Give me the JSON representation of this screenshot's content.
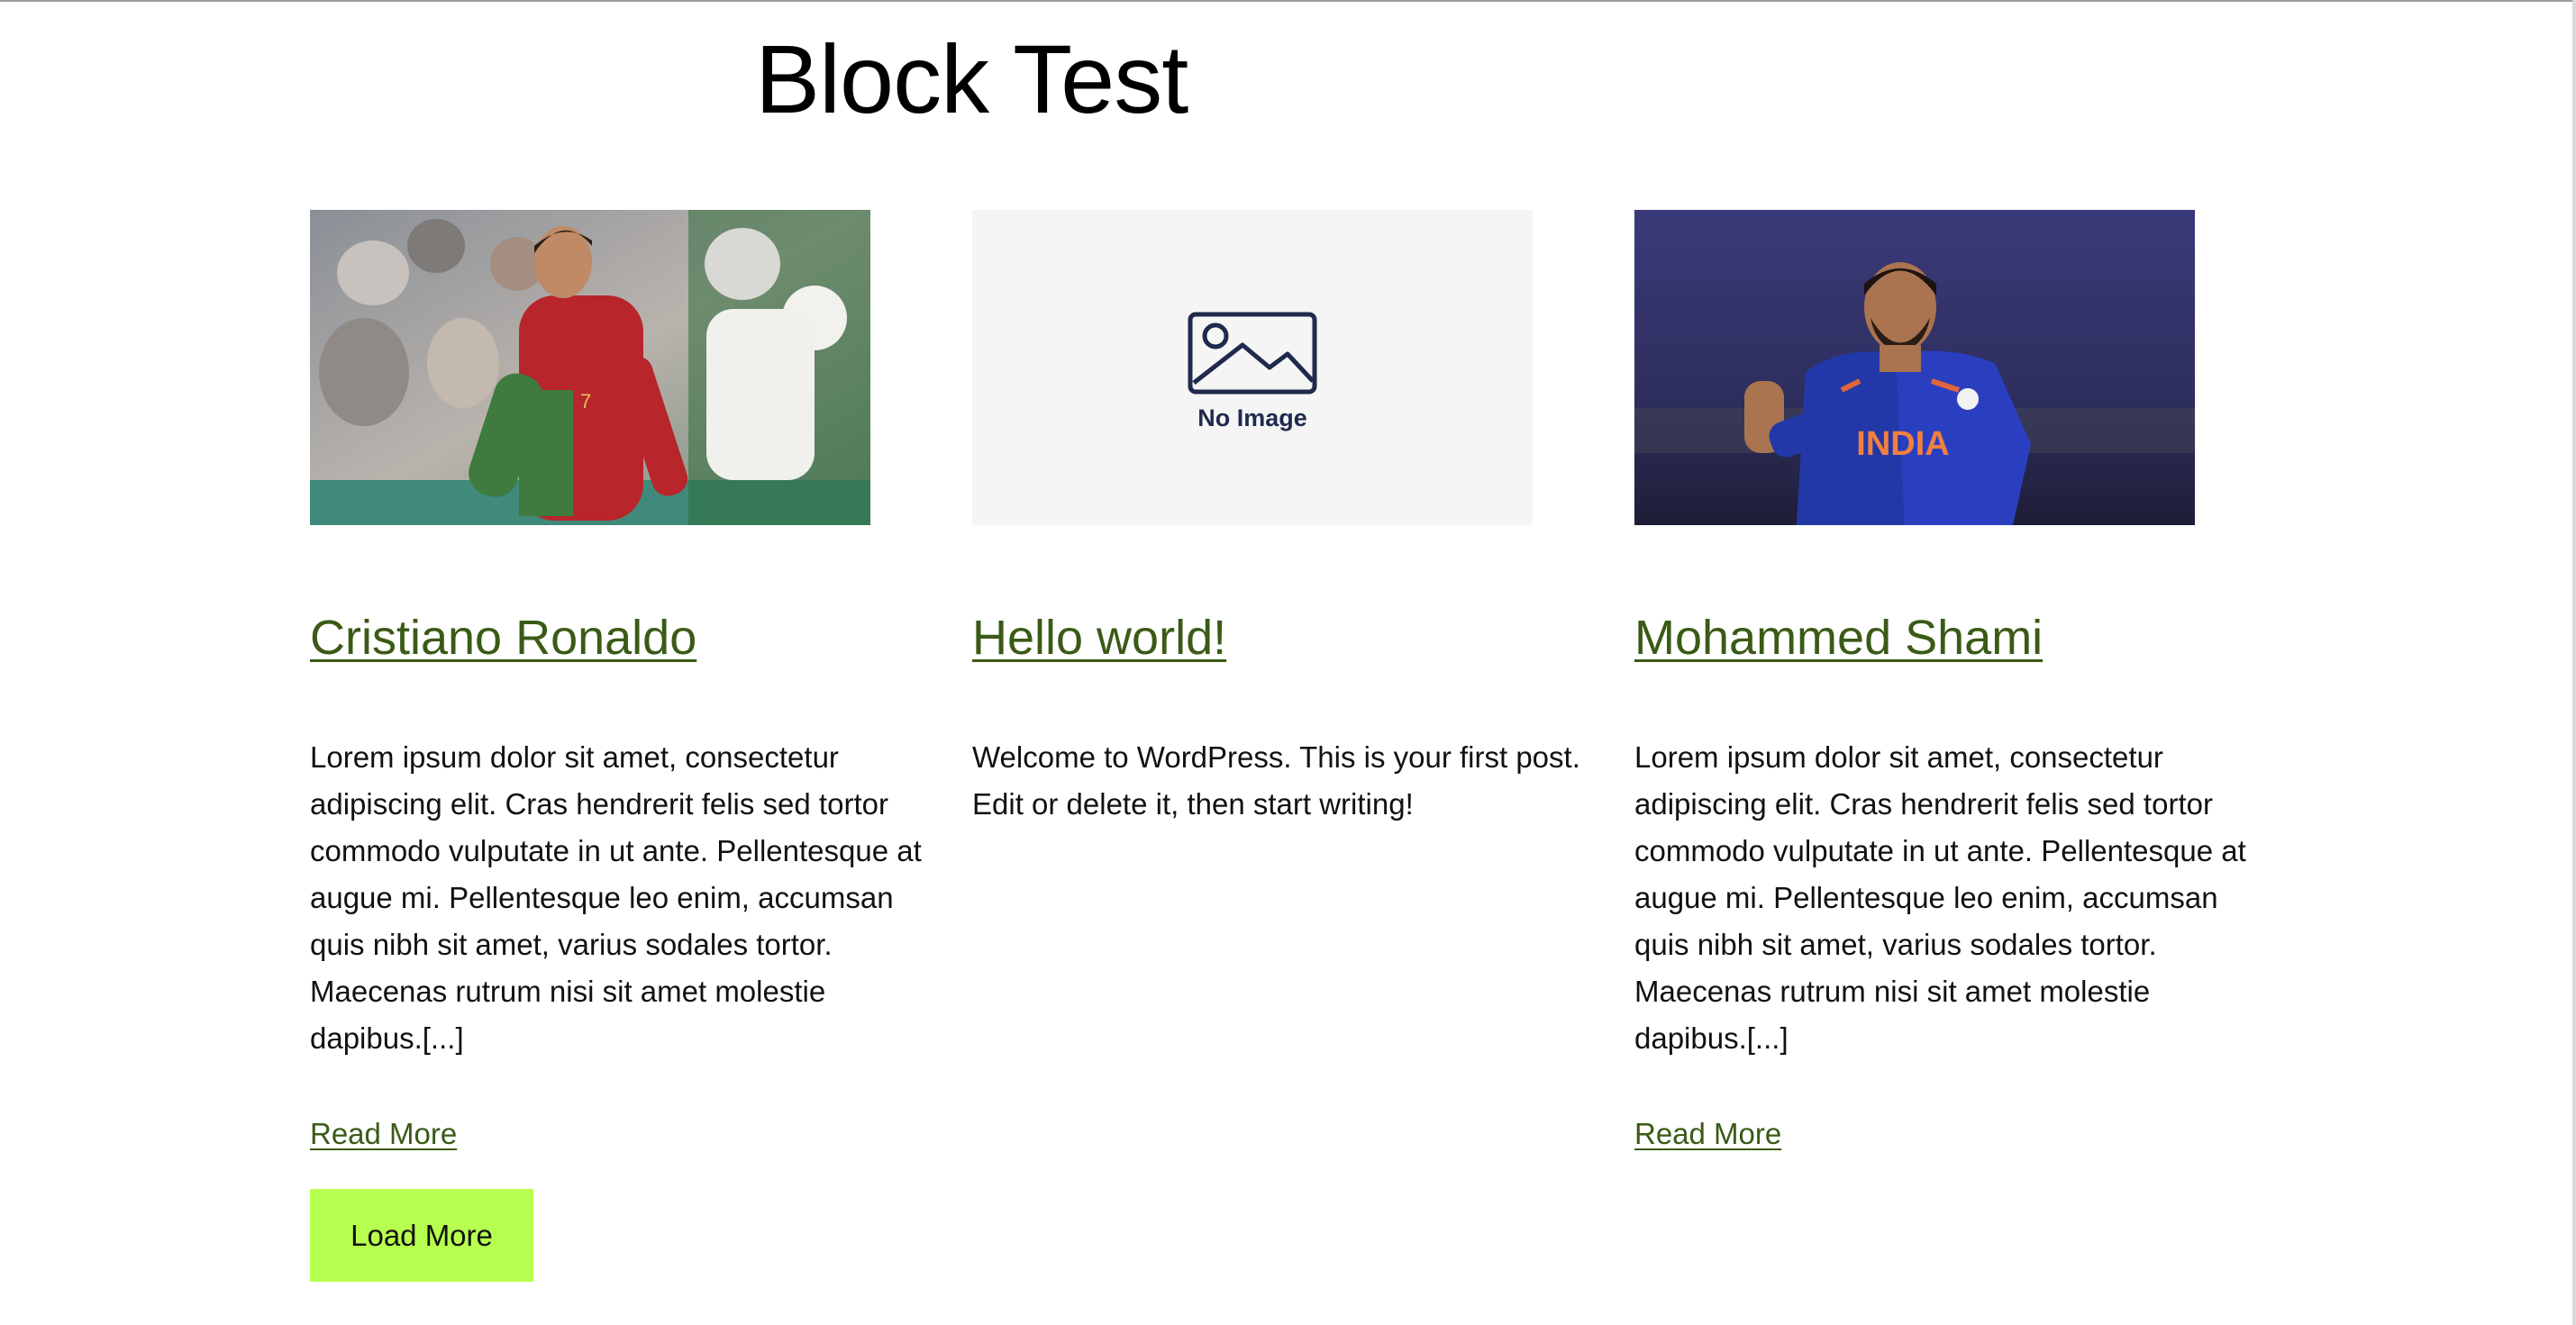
{
  "page": {
    "title": "Block Test"
  },
  "posts": [
    {
      "title": "Cristiano Ronaldo",
      "excerpt": "Lorem ipsum dolor sit amet, consectetur adipiscing elit. Cras hendrerit felis sed tortor commodo vulputate in ut ante. Pellentesque at augue mi. Pellentesque leo enim, accumsan quis nibh sit amet, varius sodales tortor. Maecenas rutrum nisi sit amet molestie dapibus.[...]",
      "read_more": "Read More",
      "thumbnail": "footballer-photo"
    },
    {
      "title": "Hello world!",
      "excerpt": "Welcome to WordPress. This is your first post. Edit or delete it, then start writing!",
      "read_more": "",
      "thumbnail": "no-image-placeholder",
      "thumbnail_label": "No Image"
    },
    {
      "title": "Mohammed Shami",
      "excerpt": "Lorem ipsum dolor sit amet, consectetur adipiscing elit. Cras hendrerit felis sed tortor commodo vulputate in ut ante. Pellentesque at augue mi. Pellentesque leo enim, accumsan quis nibh sit amet, varius sodales tortor. Maecenas rutrum nisi sit amet molestie dapibus.[...]",
      "read_more": "Read More",
      "thumbnail": "cricketer-photo",
      "thumbnail_jersey_text": "INDIA"
    }
  ],
  "load_more": {
    "label": "Load More"
  },
  "colors": {
    "link": "#3a5a16",
    "button": "#b7ff4f",
    "placeholder_bg": "#f5f5f5",
    "placeholder_icon": "#1f2a4d"
  }
}
